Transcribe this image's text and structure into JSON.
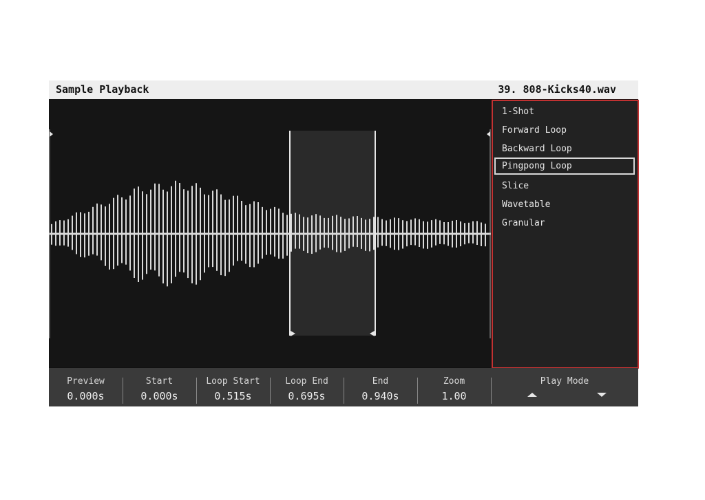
{
  "header": {
    "title": "Sample Playback",
    "sample_index": "39.",
    "sample_name": "808-Kicks40.wav"
  },
  "play_modes": {
    "options": [
      "1-Shot",
      "Forward Loop",
      "Backward Loop",
      "Pingpong Loop",
      "Slice",
      "Wavetable",
      "Granular"
    ],
    "selected": "Pingpong Loop"
  },
  "params": {
    "preview": {
      "label": "Preview",
      "value": "0.000s"
    },
    "start": {
      "label": "Start",
      "value": "0.000s"
    },
    "loop_start": {
      "label": "Loop Start",
      "value": "0.515s"
    },
    "loop_end": {
      "label": "Loop End",
      "value": "0.695s"
    },
    "end": {
      "label": "End",
      "value": "0.940s"
    },
    "zoom": {
      "label": "Zoom",
      "value": "1.00"
    },
    "play_mode": {
      "label": "Play Mode"
    }
  },
  "colors": {
    "panel_border": "#c23232",
    "waveform": "#d9d9d9",
    "loop_region": "#2a2a2a"
  },
  "icons": [
    "play-mode-up-icon",
    "play-mode-down-icon",
    "start-marker-icon",
    "end-marker-icon",
    "loop-start-marker-icon",
    "loop-end-marker-icon"
  ]
}
